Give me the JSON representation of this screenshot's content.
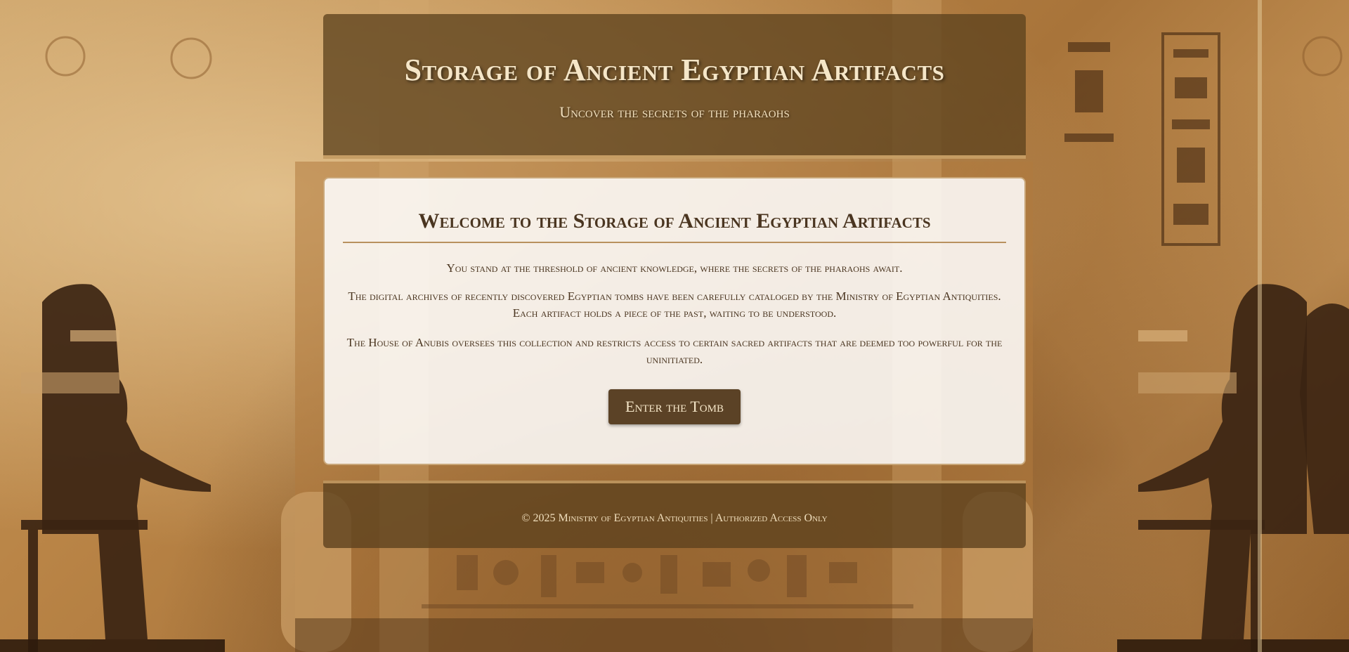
{
  "header": {
    "title": "Storage of Ancient Egyptian Artifacts",
    "subtitle": "Uncover the secrets of the pharaohs"
  },
  "main": {
    "heading": "Welcome to the Storage of Ancient Egyptian Artifacts",
    "paragraphs": [
      "You stand at the threshold of ancient knowledge, where the secrets of the pharaohs await.",
      "The digital archives of recently discovered Egyptian tombs have been carefully cataloged by the Ministry of Egyptian Antiquities. Each artifact holds a piece of the past, waiting to be understood.",
      "The House of Anubis oversees this collection and restricts access to certain sacred artifacts that are deemed too powerful for the uninitiated."
    ],
    "button_label": "Enter the Tomb"
  },
  "footer": {
    "text": "© 2025 Ministry of Egyptian Antiquities | Authorized Access Only"
  },
  "colors": {
    "header_bg": "#5e421e",
    "accent": "#b8915e",
    "button_bg": "#5b4226",
    "text_dark": "#4a3520",
    "text_light": "#f5e6c8"
  }
}
